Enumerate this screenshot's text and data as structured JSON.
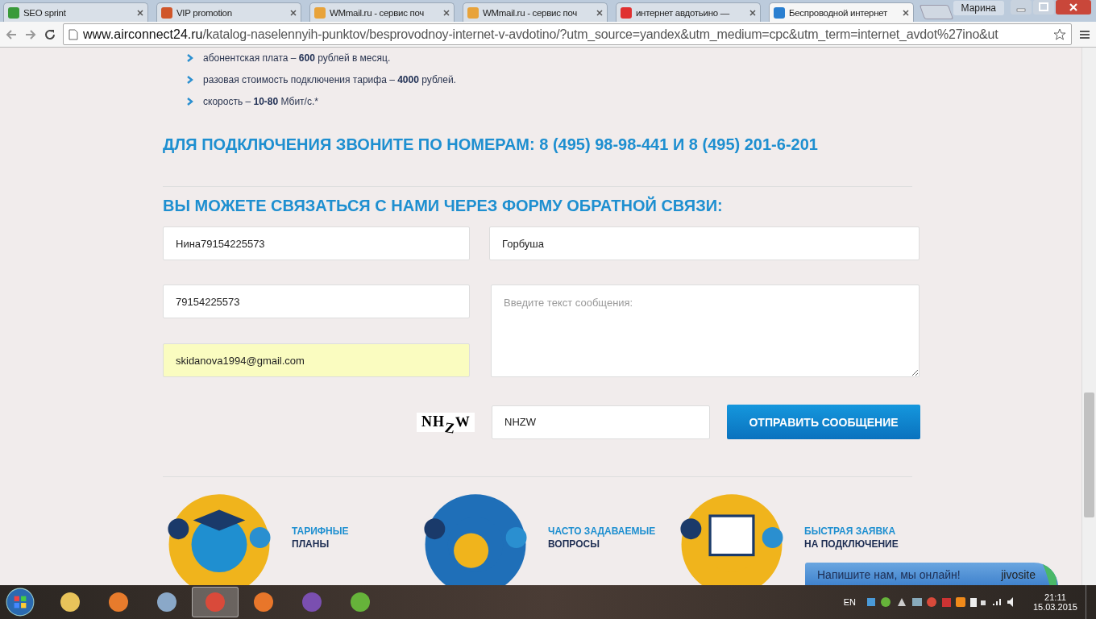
{
  "browser": {
    "tabs": [
      {
        "label": "SEO sprint",
        "kind": "seo",
        "selected": false
      },
      {
        "label": "VIP promotion",
        "kind": "vip",
        "selected": false
      },
      {
        "label": "WMmail.ru - сервис поч",
        "kind": "wmmail",
        "selected": false
      },
      {
        "label": "WMmail.ru - сервис поч",
        "kind": "wmmail",
        "selected": false
      },
      {
        "label": "интернет авдотьино — ",
        "kind": "yandex",
        "selected": false
      },
      {
        "label": "Беспроводной интернет",
        "kind": "site",
        "selected": true
      }
    ],
    "profile": "Марина",
    "url_host": "www.airconnect24.ru",
    "url_path": "/katalog-naselennyih-punktov/besprovodnoy-internet-v-avdotino/?utm_source=yandex&utm_medium=cpc&utm_term=internet_avdot%27ino&ut"
  },
  "page": {
    "bullets": [
      "абонентская плата – **600** рублей в месяц.",
      "разовая стоимость подключения тарифа – **4000** рублей.",
      "скорость – **10-80** Мбит/с.*"
    ],
    "phone_heading": "ДЛЯ ПОДКЛЮЧЕНИЯ ЗВОНИТЕ ПО НОМЕРАМ: 8 (495) 98-98-441 И 8 (495) 201-6-201",
    "form_heading": "ВЫ МОЖЕТЕ СВЯЗАТЬСЯ С НАМИ ЧЕРЕЗ ФОРМУ ОБРАТНОЙ СВЯЗИ:",
    "form": {
      "name": {
        "value": "Нина79154225573",
        "autofilled": false
      },
      "surname": {
        "value": "Горбуша",
        "autofilled": false
      },
      "phone": {
        "value": "79154225573",
        "autofilled": false
      },
      "email": {
        "value": "skidanova1994@gmail.com",
        "autofilled": true
      },
      "message": {
        "placeholder": "Введите текст сообщения:"
      },
      "captcha_letters": [
        "N",
        "H",
        "Z",
        "W"
      ],
      "captcha_field": {
        "value": "NHZW"
      },
      "submit": "ОТПРАВИТЬ СООБЩЕНИЕ"
    },
    "features": [
      {
        "kind": "tariffs",
        "line1": "ТАРИФНЫЕ",
        "line2": "ПЛАНЫ"
      },
      {
        "kind": "faq",
        "line1": "ЧАСТО ЗАДАВАЕМЫЕ",
        "line2": "ВОПРОСЫ"
      },
      {
        "kind": "request",
        "line1": "БЫСТРАЯ ЗАЯВКА",
        "line2": "НА ПОДКЛЮЧЕНИЕ"
      }
    ],
    "chat": {
      "text": "Напишите нам, мы онлайн!",
      "brand": "jivosite"
    }
  },
  "taskbar": {
    "apps": [
      {
        "kind": "explorer",
        "selected": false
      },
      {
        "kind": "media",
        "selected": false
      },
      {
        "kind": "calculator",
        "selected": false
      },
      {
        "kind": "chrome",
        "selected": true
      },
      {
        "kind": "firefox",
        "selected": false
      },
      {
        "kind": "vs",
        "selected": false
      },
      {
        "kind": "torrent",
        "selected": false
      }
    ],
    "language": "EN",
    "time": "21:11",
    "date": "15.03.2015"
  }
}
